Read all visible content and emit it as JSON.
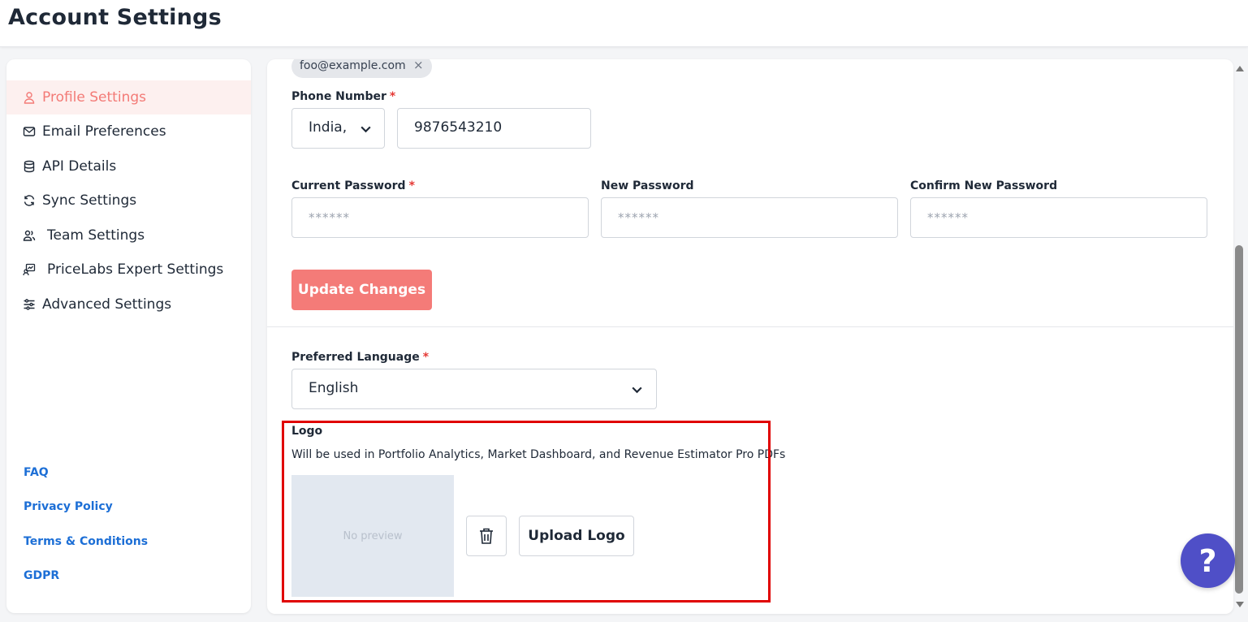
{
  "header": {
    "title": "Account Settings"
  },
  "sidebar": {
    "items": [
      {
        "label": "Profile Settings",
        "icon": "user-icon",
        "active": true
      },
      {
        "label": "Email Preferences",
        "icon": "mail-icon"
      },
      {
        "label": "API Details",
        "icon": "database-icon"
      },
      {
        "label": "Sync Settings",
        "icon": "sync-icon"
      },
      {
        "label": "Team Settings",
        "icon": "team-icon"
      },
      {
        "label": "PriceLabs Expert Settings",
        "icon": "expert-icon"
      },
      {
        "label": "Advanced Settings",
        "icon": "sliders-icon"
      }
    ],
    "footer_links": [
      "FAQ",
      "Privacy Policy",
      "Terms & Conditions",
      "GDPR"
    ]
  },
  "form": {
    "email_chip": "foo@example.com",
    "chip_remove": "×",
    "phone": {
      "label": "Phone Number",
      "country": "India, ·",
      "number": "9876543210"
    },
    "required_mark": "*",
    "current_password": {
      "label": "Current Password",
      "placeholder": "******"
    },
    "new_password": {
      "label": "New Password",
      "placeholder": "******"
    },
    "confirm_password": {
      "label": "Confirm New Password",
      "placeholder": "******"
    },
    "update_button": "Update Changes",
    "language": {
      "label": "Preferred Language",
      "value": "English"
    },
    "logo": {
      "label": "Logo",
      "description": "Will be used in Portfolio Analytics, Market Dashboard, and Revenue Estimator Pro PDFs",
      "preview_text": "No preview",
      "upload_button": "Upload Logo"
    }
  },
  "help": {
    "label": "?"
  },
  "colors": {
    "accent": "#f47b78",
    "link": "#1d6fd6",
    "highlight": "#e00000",
    "help_button": "#4f4fc7"
  }
}
